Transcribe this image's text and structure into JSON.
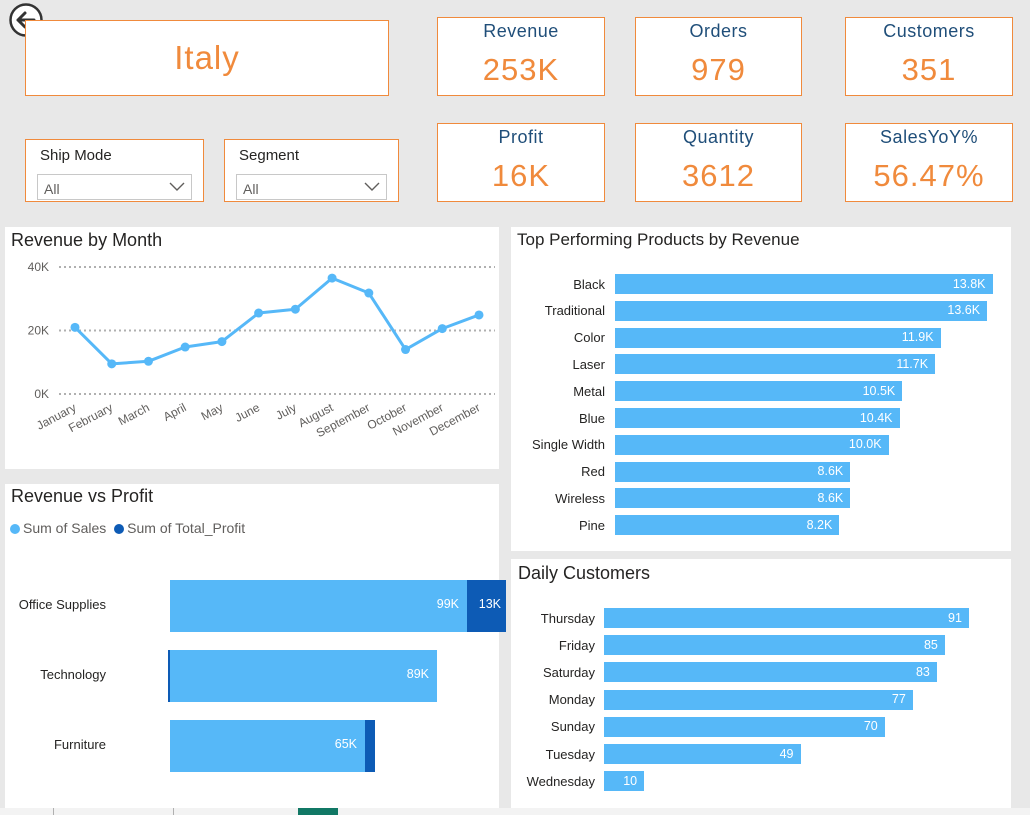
{
  "header": {
    "country": "Italy",
    "kpis": [
      {
        "label": "Revenue",
        "value": "253K"
      },
      {
        "label": "Orders",
        "value": "979"
      },
      {
        "label": "Customers",
        "value": "351"
      },
      {
        "label": "Profit",
        "value": "16K"
      },
      {
        "label": "Quantity",
        "value": "3612"
      },
      {
        "label": "SalesYoY%",
        "value": "56.47%"
      }
    ]
  },
  "filters": {
    "ship_mode": {
      "label": "Ship Mode",
      "value": "All"
    },
    "segment": {
      "label": "Segment",
      "value": "All"
    }
  },
  "colors": {
    "accent": "#f08a3c",
    "kpi_label": "#1f4e79",
    "sales": "#56b8f8",
    "profit": "#0d5bb5"
  },
  "icons": {
    "back": "back-arrow-icon",
    "dropdown": "chevron-down-icon"
  },
  "chart_data": [
    {
      "type": "line",
      "title": "Revenue by Month",
      "x": [
        "January",
        "February",
        "March",
        "April",
        "May",
        "June",
        "July",
        "August",
        "September",
        "October",
        "November",
        "December"
      ],
      "y": [
        21000,
        9500,
        10300,
        14800,
        16500,
        25500,
        26700,
        36500,
        31800,
        14000,
        20600,
        24900
      ],
      "y_ticks": [
        "0K",
        "20K",
        "40K"
      ],
      "ylim": [
        0,
        40000
      ],
      "grid": true
    },
    {
      "type": "bar",
      "title": "Top Performing Products by Revenue",
      "categories": [
        "Black",
        "Traditional",
        "Color",
        "Laser",
        "Metal",
        "Blue",
        "Single Width",
        "Red",
        "Wireless",
        "Pine"
      ],
      "values": [
        13.8,
        13.6,
        11.9,
        11.7,
        10.5,
        10.4,
        10.0,
        8.6,
        8.6,
        8.2
      ],
      "labels": [
        "13.8K",
        "13.6K",
        "11.9K",
        "11.7K",
        "10.5K",
        "10.4K",
        "10.0K",
        "8.6K",
        "8.6K",
        "8.2K"
      ],
      "xlim": [
        0,
        14
      ]
    },
    {
      "type": "bar",
      "title": "Revenue vs Profit",
      "categories": [
        "Office Supplies",
        "Technology",
        "Furniture"
      ],
      "series": [
        {
          "name": "Sum of Sales",
          "values": [
            99,
            89,
            65
          ],
          "labels": [
            "99K",
            "89K",
            "65K"
          ]
        },
        {
          "name": "Sum of Total_Profit",
          "values": [
            13,
            0.3,
            3.2
          ],
          "labels": [
            "13K",
            "",
            ""
          ]
        }
      ],
      "stacked": true,
      "xlim": [
        0,
        110
      ]
    },
    {
      "type": "bar",
      "title": "Daily Customers",
      "categories": [
        "Thursday",
        "Friday",
        "Saturday",
        "Monday",
        "Sunday",
        "Tuesday",
        "Wednesday"
      ],
      "values": [
        91,
        85,
        83,
        77,
        70,
        49,
        10
      ],
      "xlim": [
        0,
        96
      ]
    }
  ]
}
